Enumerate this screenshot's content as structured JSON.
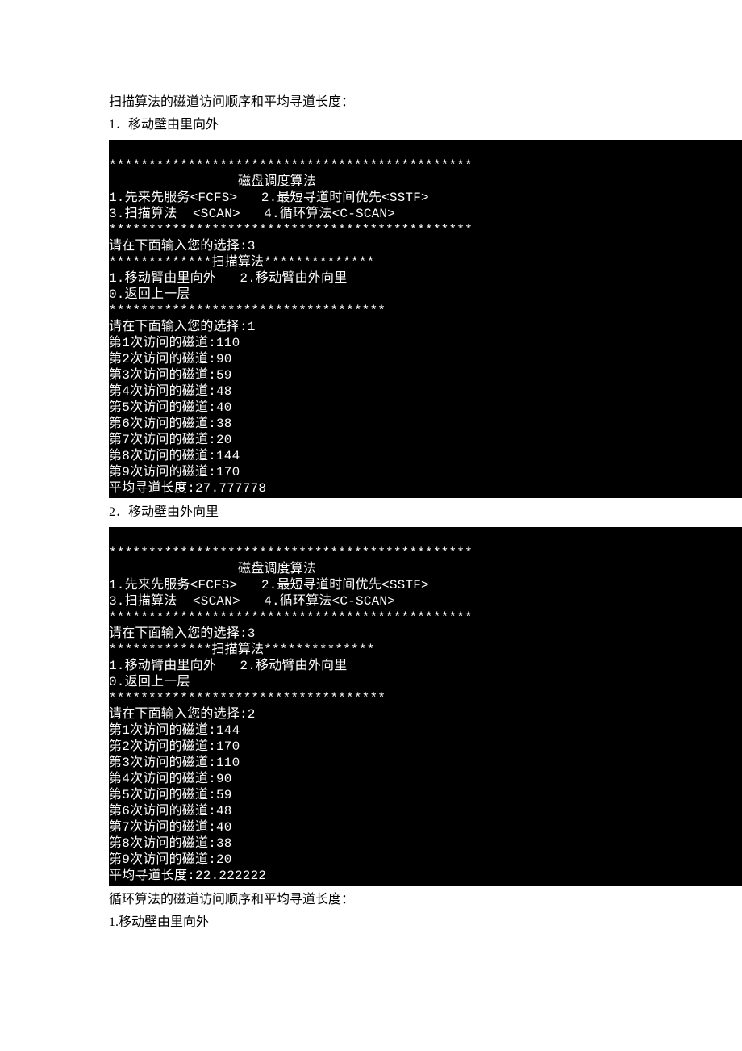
{
  "section1": {
    "heading": "扫描算法的磁道访问顺序和平均寻道长度：",
    "sub": "1．移动壁由里向外",
    "terminal": {
      "stars1": "**********************************************",
      "title": "磁盘调度算法",
      "menu1": "1.先来先服务<FCFS>   2.最短寻道时间优先<SSTF>",
      "menu2": "3.扫描算法  <SCAN>   4.循环算法<C-SCAN>",
      "stars2": "**********************************************",
      "prompt1": "请在下面输入您的选择:3",
      "scanHeader": "*************扫描算法**************",
      "scanMenu1": "1.移动臂由里向外   2.移动臂由外向里",
      "scanMenu2": "0.返回上一层",
      "stars3": "***********************************",
      "prompt2": "请在下面输入您的选择:1",
      "lines": [
        "第1次访问的磁道:110",
        "第2次访问的磁道:90",
        "第3次访问的磁道:59",
        "第4次访问的磁道:48",
        "第5次访问的磁道:40",
        "第6次访问的磁道:38",
        "第7次访问的磁道:20",
        "第8次访问的磁道:144",
        "第9次访问的磁道:170"
      ],
      "avg": "平均寻道长度:27.777778"
    }
  },
  "section2": {
    "sub": "2．移动壁由外向里",
    "terminal": {
      "stars1": "**********************************************",
      "title": "磁盘调度算法",
      "menu1": "1.先来先服务<FCFS>   2.最短寻道时间优先<SSTF>",
      "menu2": "3.扫描算法  <SCAN>   4.循环算法<C-SCAN>",
      "stars2": "**********************************************",
      "prompt1": "请在下面输入您的选择:3",
      "scanHeader": "*************扫描算法**************",
      "scanMenu1": "1.移动臂由里向外   2.移动臂由外向里",
      "scanMenu2": "0.返回上一层",
      "stars3": "***********************************",
      "prompt2": "请在下面输入您的选择:2",
      "lines": [
        "第1次访问的磁道:144",
        "第2次访问的磁道:170",
        "第3次访问的磁道:110",
        "第4次访问的磁道:90",
        "第5次访问的磁道:59",
        "第6次访问的磁道:48",
        "第7次访问的磁道:40",
        "第8次访问的磁道:38",
        "第9次访问的磁道:20"
      ],
      "avg": "平均寻道长度:22.222222"
    }
  },
  "section3": {
    "heading": "循环算法的磁道访问顺序和平均寻道长度：",
    "sub": "1.移动壁由里向外"
  }
}
